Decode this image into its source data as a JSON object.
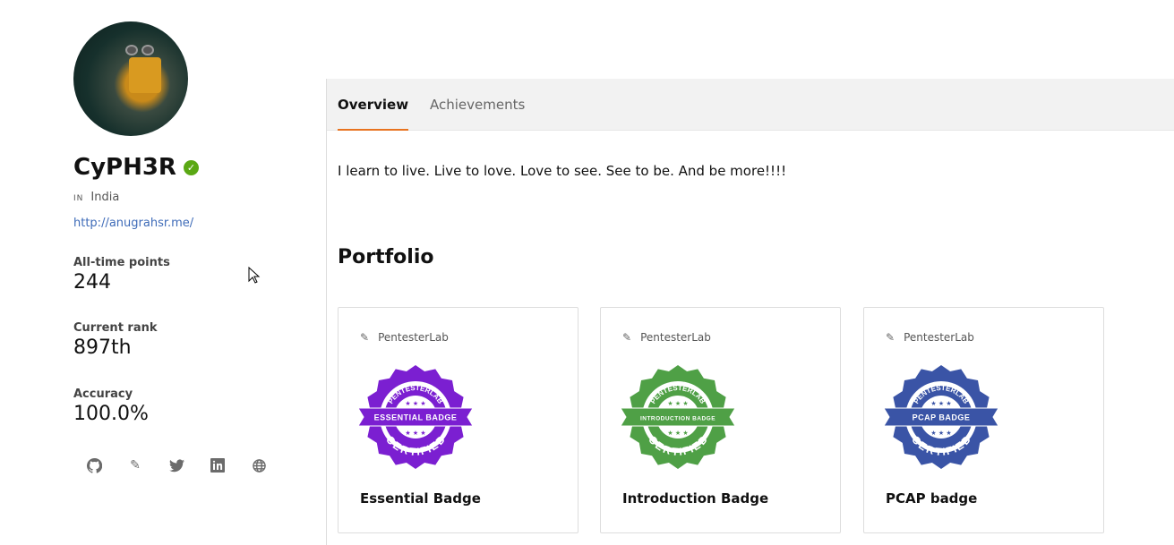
{
  "profile": {
    "username": "CyPH3R",
    "verified": true,
    "country_code": "IN",
    "country": "India",
    "website": "http://anugrahsr.me/"
  },
  "stats": [
    {
      "label": "All-time points",
      "value": "244"
    },
    {
      "label": "Current rank",
      "value": "897th"
    },
    {
      "label": "Accuracy",
      "value": "100.0%"
    }
  ],
  "socials": [
    "github-icon",
    "pentesterlab-icon",
    "twitter-icon",
    "linkedin-icon",
    "globe-icon"
  ],
  "tabs": [
    {
      "label": "Overview",
      "active": true
    },
    {
      "label": "Achievements",
      "active": false
    }
  ],
  "bio": "I learn to live. Live to love. Love to see. See to be. And be more!!!!",
  "portfolio": {
    "heading": "Portfolio",
    "cards": [
      {
        "source": "PentesterLab",
        "title": "Essential Badge",
        "badge_text": "ESSENTIAL BADGE",
        "color": "#7b1fd1"
      },
      {
        "source": "PentesterLab",
        "title": "Introduction Badge",
        "badge_text": "INTRODUCTION BADGE",
        "color": "#4fa046"
      },
      {
        "source": "PentesterLab",
        "title": "PCAP badge",
        "badge_text": "PCAP BADGE",
        "color": "#3a54a6"
      }
    ]
  },
  "badge_lettering": {
    "top": "PENTESTERLAB",
    "bottom": "CERTIFIED"
  }
}
